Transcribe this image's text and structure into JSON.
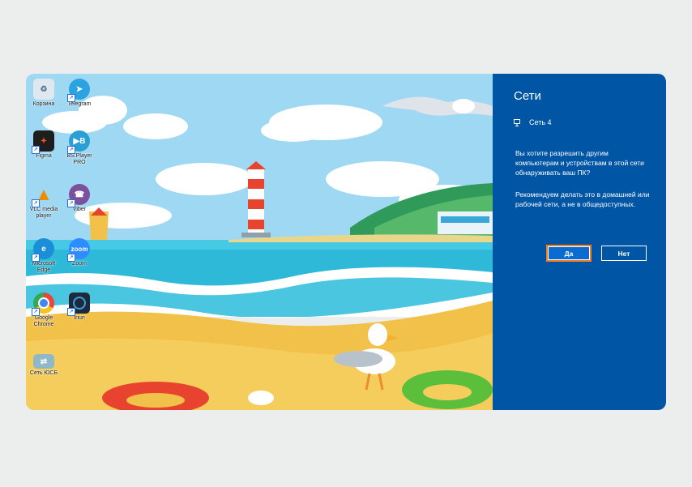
{
  "desktop": {
    "icons": [
      {
        "label": "Корзина",
        "icon": "recycle-bin-icon",
        "color": "#dfe7ef"
      },
      {
        "label": "Telegram",
        "icon": "telegram-icon",
        "color": "#2aa3e0"
      },
      {
        "label": "Figma",
        "icon": "figma-icon",
        "color": "#1e1e1e"
      },
      {
        "label": "BS.Player PRO",
        "icon": "bsplayer-icon",
        "color": "#2a9fd6"
      },
      {
        "label": "VLC media player",
        "icon": "vlc-icon",
        "color": "#f08a00"
      },
      {
        "label": "Viber",
        "icon": "viber-icon",
        "color": "#7b519d"
      },
      {
        "label": "Microsoft Edge",
        "icon": "edge-icon",
        "color": "#1a8fd8"
      },
      {
        "label": "Zoom",
        "icon": "zoom-icon",
        "color": "#2d8cff"
      },
      {
        "label": "Google Chrome",
        "icon": "chrome-icon",
        "color": "#e8453c"
      },
      {
        "label": "Iriun",
        "icon": "iriun-icon",
        "color": "#1e2a3a"
      },
      {
        "label": "Сеть ЮСБ",
        "icon": "network-usb-icon",
        "color": "#8fb8c8"
      }
    ],
    "zoom_text": "zoom"
  },
  "flyout": {
    "title": "Сети",
    "network_name": "Сеть 4",
    "question": "Вы хотите разрешить другим компьютерам и устройствам в этой сети обнаруживать ваш ПК?",
    "recommendation": "Рекомендуем делать это в домашней или рабочей сети, а не в общедоступных.",
    "yes_label": "Да",
    "no_label": "Нет",
    "background_color": "#0055a5"
  }
}
